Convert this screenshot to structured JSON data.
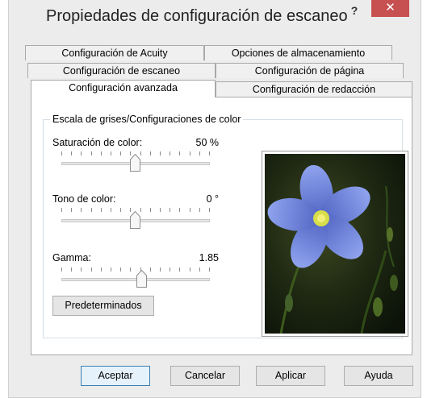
{
  "window": {
    "title": "Propiedades de configuración de escaneo",
    "help_label": "?",
    "close_label": "✕"
  },
  "tabs": [
    {
      "label": "Configuración de Acuity"
    },
    {
      "label": "Opciones de almacenamiento"
    },
    {
      "label": "Configuración de escaneo"
    },
    {
      "label": "Configuración de página"
    },
    {
      "label": "Configuración avanzada",
      "active": true
    },
    {
      "label": "Configuración de redacción"
    }
  ],
  "group": {
    "title": "Escala de grises/Configuraciones de color",
    "sliders": [
      {
        "label": "Saturación de color:",
        "value": "50 %",
        "level": 0.5
      },
      {
        "label": "Tono de color:",
        "value": "0 °",
        "level": 0.5
      },
      {
        "label": "Gamma:",
        "value": "1.85",
        "level": 0.55
      }
    ],
    "defaults_button": "Predeterminados"
  },
  "footer": {
    "accept": "Aceptar",
    "cancel": "Cancelar",
    "apply": "Aplicar",
    "help": "Ayuda"
  },
  "colors": {
    "close_red": "#c75050",
    "petal_blue": "#6f86d8"
  }
}
